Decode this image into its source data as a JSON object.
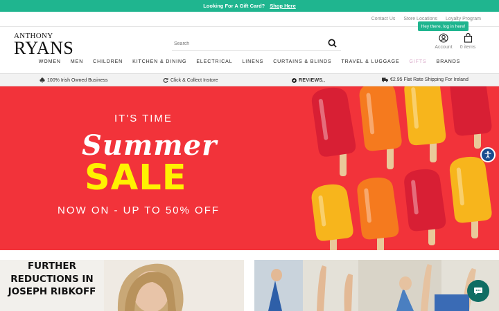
{
  "promo": {
    "text": "Looking For A Gift Card?",
    "link": "Shop Here"
  },
  "utility_links": [
    "Contact Us",
    "Store Locations",
    "Loyalty Program"
  ],
  "logo": {
    "line1": "ANTHONY",
    "line2": "RYANS"
  },
  "search": {
    "placeholder": "Search"
  },
  "tooltip": "Hey there, log in here!",
  "account": {
    "label": "Account"
  },
  "cart": {
    "label": "0 items"
  },
  "nav": [
    "WOMEN",
    "MEN",
    "CHILDREN",
    "KITCHEN & DINING",
    "ELECTRICAL",
    "LINENS",
    "CURTAINS & BLINDS",
    "TRAVEL & LUGGAGE",
    "GIFTS",
    "BRANDS"
  ],
  "usp": {
    "irish": "100% Irish Owned Business",
    "collect": "Click & Collect Instore",
    "reviews": "REVIEWS",
    "reviews_suffix": "io",
    "shipping": "€2.95 Flat Rate Shipping For Ireland"
  },
  "hero": {
    "line1": "IT'S TIME",
    "line2": "Summer",
    "line3": "SALE",
    "line4": "NOW ON - UP TO 50% OFF"
  },
  "tile1": {
    "text": "FURTHER REDUCTIONS IN JOSEPH RIBKOFF"
  },
  "colors": {
    "brand_green": "#1fb58f",
    "hero_red": "#f2333a",
    "sale_yellow": "#fff200",
    "chat_green": "#0f6d63",
    "a11y_blue": "#1a4d8f"
  }
}
